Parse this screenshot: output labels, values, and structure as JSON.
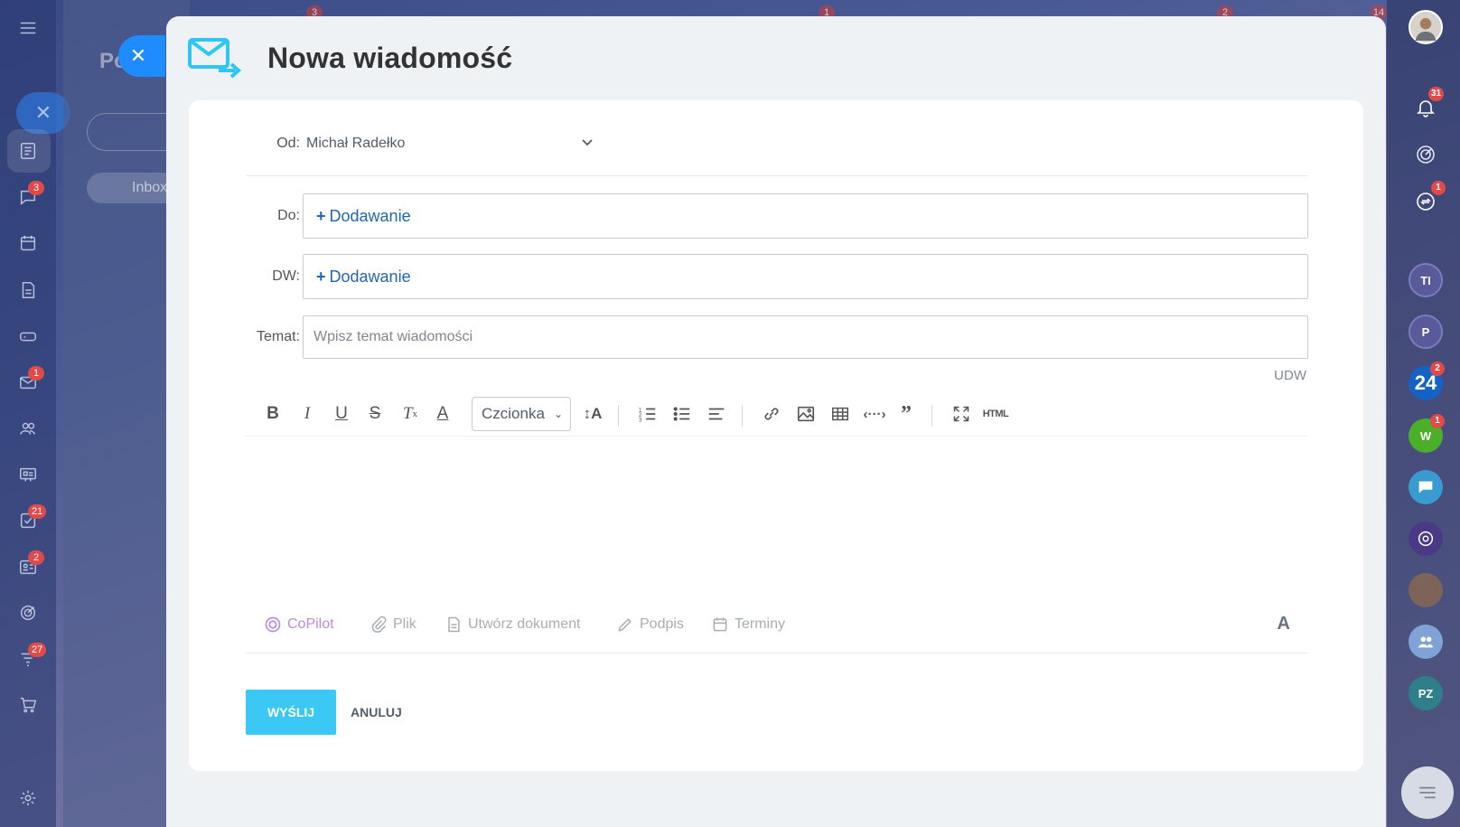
{
  "slider": {
    "title": "Nowa wiadomość",
    "close_icon": "close-icon"
  },
  "background": {
    "title": "Po",
    "inbox": "Inbox",
    "left_badges": [
      "3",
      "1",
      "21",
      "2",
      "27"
    ],
    "top_badges": [
      "3",
      "1",
      "2",
      "14"
    ]
  },
  "form": {
    "from_label": "Od:",
    "from_value": "Michał Radełko",
    "to_label": "Do:",
    "cc_label": "DW:",
    "add_label": "Dodawanie",
    "subject_label": "Temat:",
    "subject_placeholder": "Wpisz temat wiadomości",
    "bcc_label": "UDW"
  },
  "toolbar": {
    "font_select": "Czcionka",
    "html_label": "HTML",
    "icons": [
      "bold-icon",
      "italic-icon",
      "underline-icon",
      "strikethrough-icon",
      "clear-format-icon",
      "text-color-icon",
      "font-size-icon",
      "numbered-list-icon",
      "bullet-list-icon",
      "align-icon",
      "link-icon",
      "image-icon",
      "table-icon",
      "code-icon",
      "quote-icon",
      "fullscreen-icon"
    ]
  },
  "bottom_tools": {
    "copilot": "CoPilot",
    "file": "Plik",
    "create_doc": "Utwórz dokument",
    "signature": "Podpis",
    "dates": "Terminy",
    "font": "A"
  },
  "actions": {
    "send": "WYŚLIJ",
    "cancel": "ANULUJ"
  },
  "right_bar": {
    "notifications_badge": "31",
    "sync_badge": "1",
    "avatar_ti": "TI",
    "avatar_p": "P",
    "b24_label": "24",
    "b24_badge": "2",
    "avatar_w": "W",
    "w_badge": "1",
    "avatar_pz": "PZ"
  },
  "colors": {
    "accent": "#3bc8f5",
    "link": "#2066b0",
    "close": "#1e8cff",
    "badge": "#e24a4a"
  }
}
